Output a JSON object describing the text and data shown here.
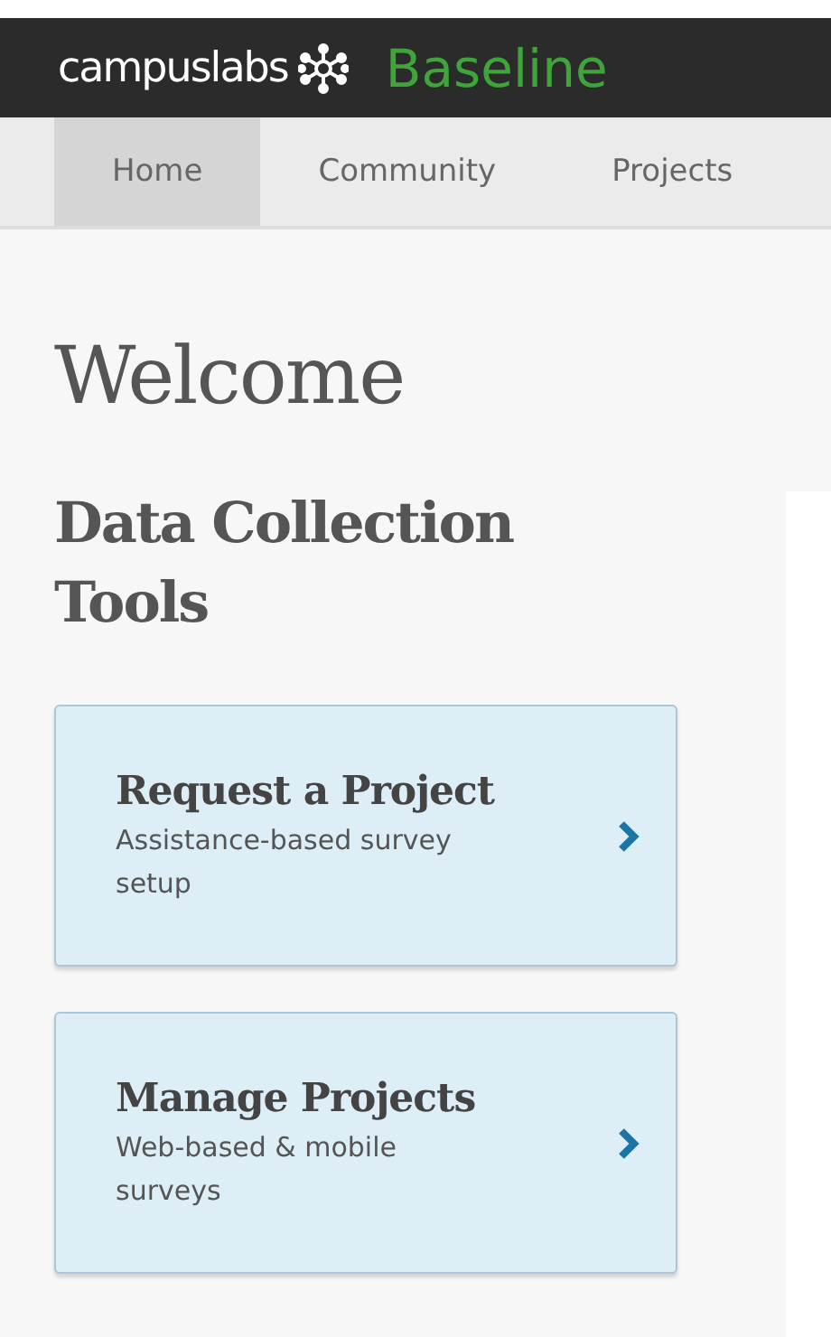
{
  "header": {
    "brand": "campuslabs",
    "product": "Baseline"
  },
  "tabs": [
    {
      "label": "Home",
      "selected": true
    },
    {
      "label": "Community",
      "selected": false
    },
    {
      "label": "Projects",
      "selected": false
    }
  ],
  "page_title": "Welcome",
  "section_title": "Data Collection Tools",
  "cards": [
    {
      "title": "Request a Project",
      "description": "Assistance-based survey setup"
    },
    {
      "title": "Manage Projects",
      "description": "Web-based & mobile surveys"
    }
  ]
}
